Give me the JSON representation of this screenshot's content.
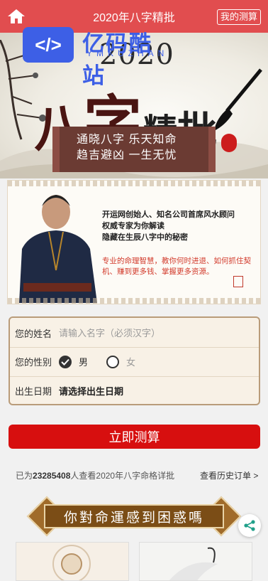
{
  "header": {
    "title": "2020年八字精批",
    "my_orders_label": "我的测算"
  },
  "watermark": {
    "logo_text": "</>",
    "name": "亿码酷站",
    "sub": "YMKUZHAN"
  },
  "banner": {
    "year": "2020",
    "title_chars": [
      "八",
      "字",
      "精",
      "批"
    ],
    "slogan_line1": "通晓八字  乐天知命",
    "slogan_line2": "趋吉避凶  一生无忧"
  },
  "master": {
    "line1": "开运网创始人、知名公司首席风水顾问",
    "line2": "权威专家为你解读",
    "line3": "隐藏在生辰八字中的秘密",
    "desc": "专业的命理智慧，教你何时进退、如何抓住契机、赚到更多钱、掌握更多资源。"
  },
  "form": {
    "name_label": "您的姓名",
    "name_placeholder": "请输入名字（必须汉字）",
    "gender_label": "您的性别",
    "gender_male": "男",
    "gender_female": "女",
    "gender_selected": "男",
    "birth_label": "出生日期",
    "birth_value": "请选择出生日期"
  },
  "submit_label": "立即测算",
  "stats": {
    "prefix": "已为",
    "count": "23285408",
    "suffix": "人查看2020年八字命格详批"
  },
  "history_label": "查看历史订单 >",
  "promo_banner": "你對命運感到困惑嗎",
  "colors": {
    "header": "#e14d4f",
    "submit": "#d70f0f",
    "accent_brown": "#7b4d16"
  }
}
